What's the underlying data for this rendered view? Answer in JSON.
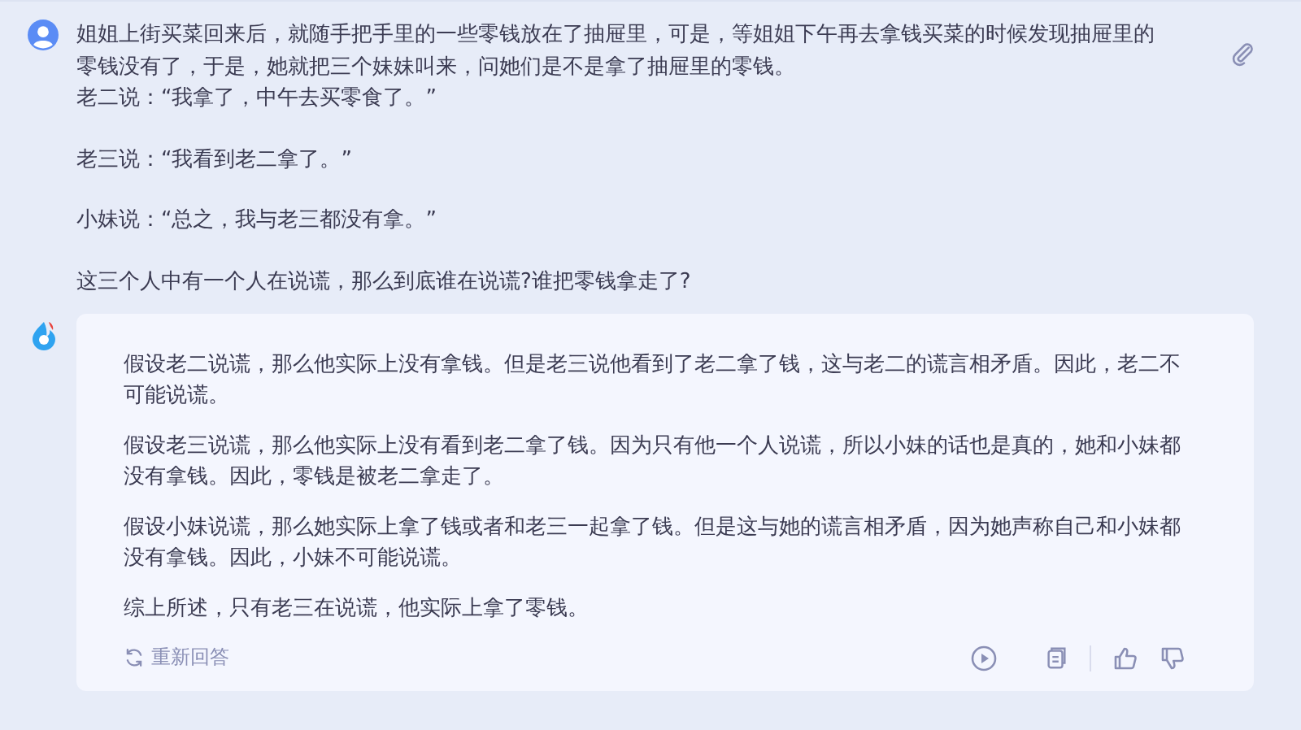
{
  "question": {
    "paragraphs": [
      "姐姐上街买菜回来后，就随手把手里的一些零钱放在了抽屉里，可是，等姐姐下午再去拿钱买菜的时候发现抽屉里的零钱没有了，于是，她就把三个妹妹叫来，问她们是不是拿了抽屉里的零钱。",
      "老二说：“我拿了，中午去买零食了。”",
      "老三说：“我看到老二拿了。”",
      "小妹说：“总之，我与老三都没有拿。”",
      "这三个人中有一个人在说谎，那么到底谁在说谎?谁把零钱拿走了?"
    ]
  },
  "answer": {
    "paragraphs": [
      "假设老二说谎，那么他实际上没有拿钱。但是老三说他看到了老二拿了钱，这与老二的谎言相矛盾。因此，老二不可能说谎。",
      "假设老三说谎，那么他实际上没有看到老二拿了钱。因为只有他一个人说谎，所以小妹的话也是真的，她和小妹都没有拿钱。因此，零钱是被老二拿走了。",
      "假设小妹说谎，那么她实际上拿了钱或者和老三一起拿了钱。但是这与她的谎言相矛盾，因为她声称自己和小妹都没有拿钱。因此，小妹不可能说谎。",
      "综上所述，只有老三在说谎，他实际上拿了零钱。"
    ],
    "regenerate": "重新回答"
  }
}
